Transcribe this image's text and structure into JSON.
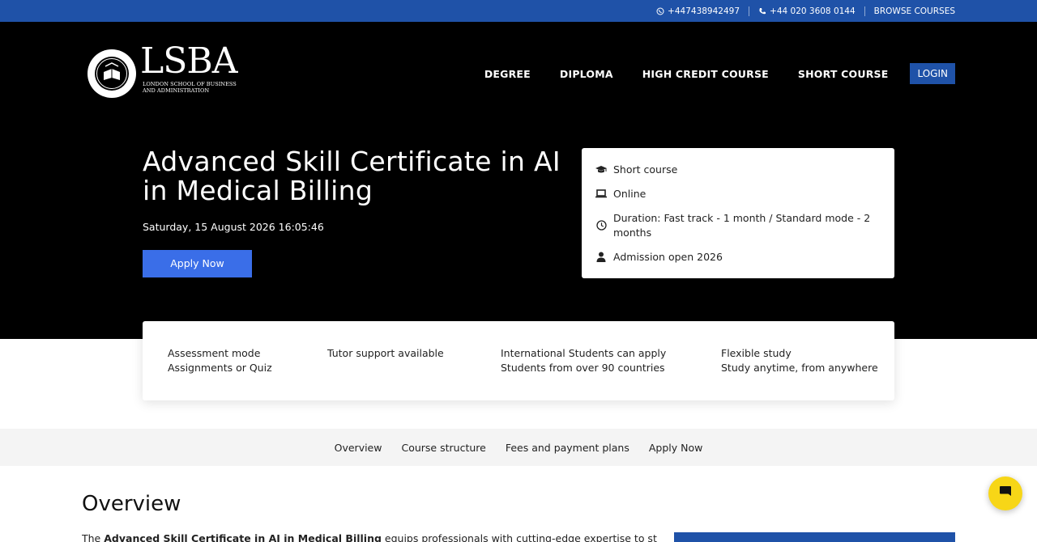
{
  "topbar": {
    "whatsapp": "+447438942497",
    "phone": "+44 020 3608 0144",
    "browse": "BROWSE COURSES",
    "bg_color": "#1f52a8"
  },
  "logo": {
    "mark": "LSBA",
    "line1": "LONDON SCHOOL OF BUSINESS",
    "line2": "AND ADMINISTRATION"
  },
  "nav": {
    "items": [
      "DEGREE",
      "DIPLOMA",
      "HIGH CREDIT COURSE",
      "SHORT COURSE"
    ],
    "login": "LOGIN"
  },
  "hero": {
    "title": "Advanced Skill Certificate in AI in Medical Billing",
    "datetime": "Saturday, 15 August 2026 16:05:46",
    "apply": "Apply Now",
    "apply_color": "#3a6ee8"
  },
  "info": [
    {
      "icon": "graduation-cap-icon",
      "text": "Short course"
    },
    {
      "icon": "laptop-icon",
      "text": "Online"
    },
    {
      "icon": "clock-icon",
      "text": "Duration: Fast track - 1 month / Standard mode - 2 months"
    },
    {
      "icon": "user-icon",
      "text": "Admission open 2026"
    }
  ],
  "features": [
    {
      "line1": "Assessment mode",
      "line2": "Assignments or Quiz"
    },
    {
      "line1": "Tutor support available",
      "line2": ""
    },
    {
      "line1": "International Students can apply",
      "line2": "Students from over 90 countries"
    },
    {
      "line1": "Flexible study",
      "line2": "Study anytime, from anywhere"
    }
  ],
  "subnav": [
    "Overview",
    "Course structure",
    "Fees and payment plans",
    "Apply Now"
  ],
  "overview": {
    "heading": "Overview",
    "text_pre": "The ",
    "text_bold": "Advanced Skill Certificate in AI in Medical Billing",
    "text_post": " equips professionals with cutting-edge expertise to streamline"
  },
  "chat": {
    "icon": "chat-icon",
    "color": "#f7d617"
  }
}
